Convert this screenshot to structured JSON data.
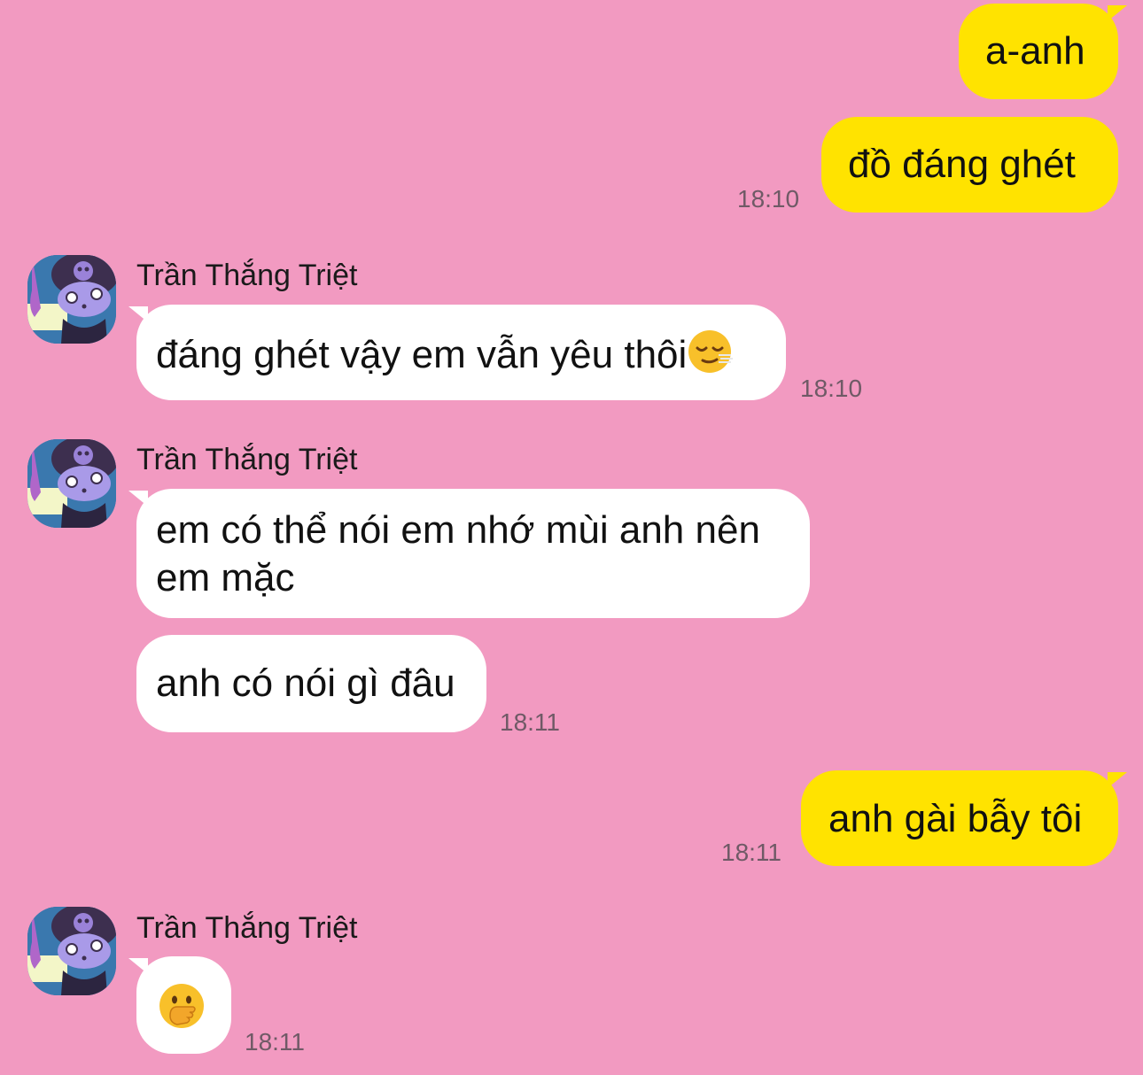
{
  "messages": [
    {
      "side": "me",
      "text": "a-anh"
    },
    {
      "side": "me",
      "text": "đồ đáng ghét",
      "time": "18:10"
    },
    {
      "side": "them",
      "sender": "Trần Thắng Triệt",
      "text": "đáng ghét vậy em vẫn yêu thôi",
      "emoji": "relieved-face-emoji",
      "time": "18:10"
    },
    {
      "side": "them",
      "sender": "Trần Thắng Triệt",
      "line1": "em có thể nói em nhớ mùi anh nên",
      "line2": "em mặc"
    },
    {
      "side": "them",
      "text": "anh có nói gì đâu",
      "time": "18:11"
    },
    {
      "side": "me",
      "text": "anh gài bẫy tôi",
      "time": "18:11"
    },
    {
      "side": "them",
      "sender": "Trần Thắng Triệt",
      "emoji": "face-with-hand-over-mouth-emoji",
      "time": "18:11"
    }
  ],
  "colors": {
    "background": "#f29ac1",
    "my_bubble": "#ffe300",
    "their_bubble": "#ffffff",
    "timestamp": "#6f5a66"
  }
}
